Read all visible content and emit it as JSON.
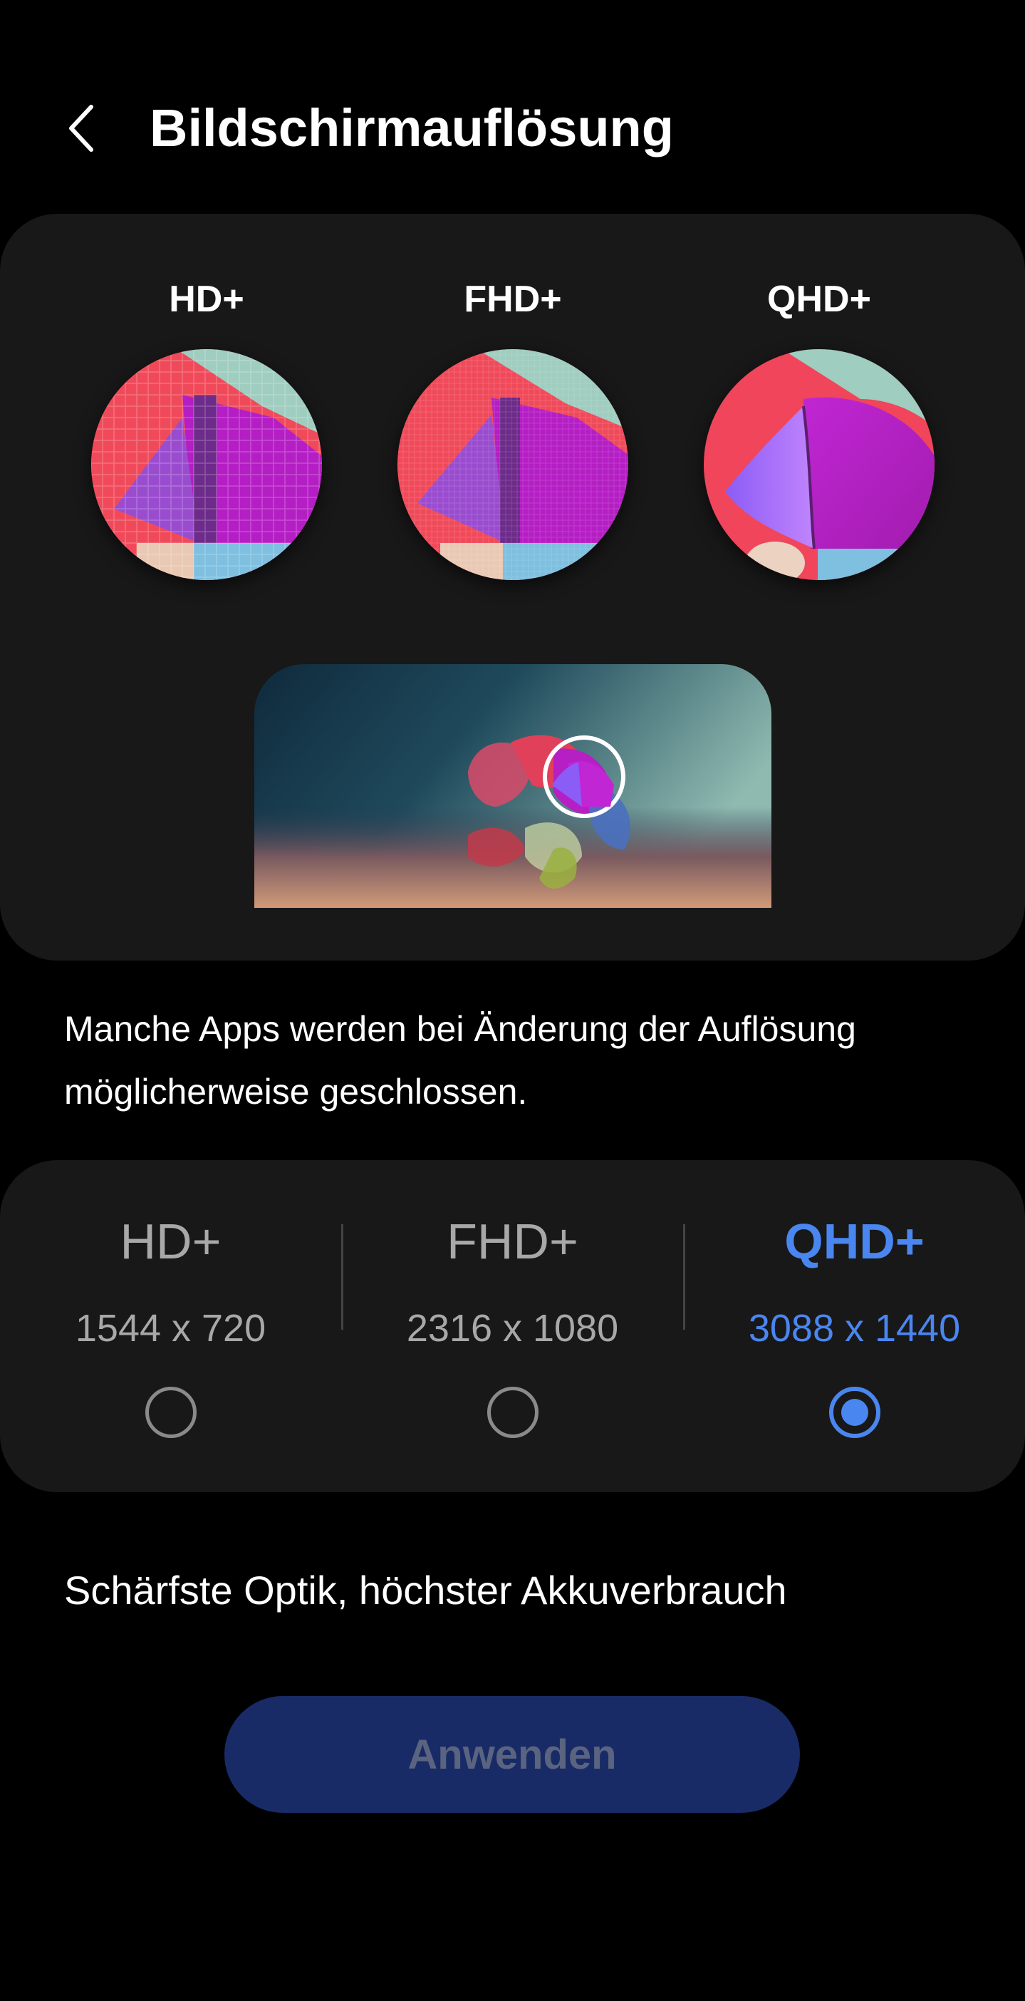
{
  "header": {
    "title": "Bildschirmauflösung"
  },
  "preview": {
    "items": [
      {
        "label": "HD+"
      },
      {
        "label": "FHD+"
      },
      {
        "label": "QHD+"
      }
    ]
  },
  "info_text": "Manche Apps werden bei Änderung der Auflösung möglicherweise geschlossen.",
  "options": [
    {
      "label": "HD+",
      "resolution": "1544 x 720",
      "selected": false
    },
    {
      "label": "FHD+",
      "resolution": "2316 x 1080",
      "selected": false
    },
    {
      "label": "QHD+",
      "resolution": "3088 x 1440",
      "selected": true
    }
  ],
  "description": "Schärfste Optik, höchster Akkuverbrauch",
  "apply_button": "Anwenden",
  "colors": {
    "accent": "#4a86f0",
    "button_bg": "#182b66",
    "card_bg": "#181818"
  }
}
